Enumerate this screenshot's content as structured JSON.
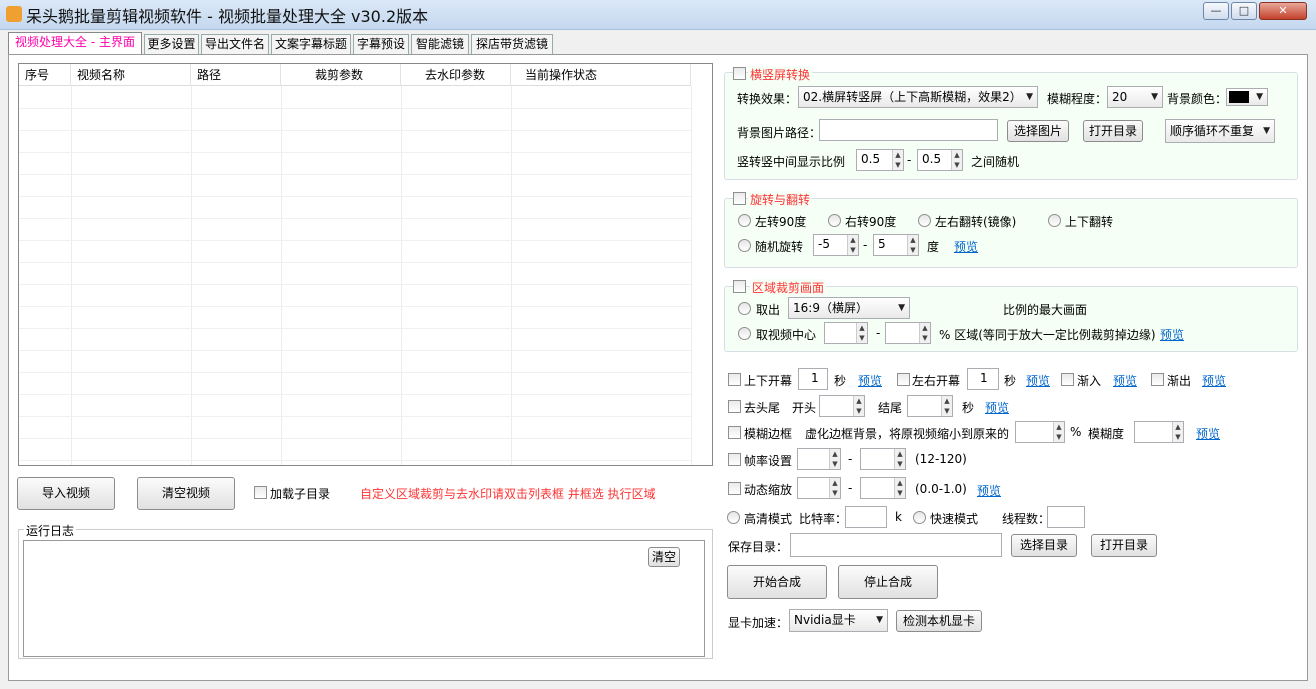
{
  "window": {
    "title": "呆头鹅批量剪辑视频软件 -  视频批量处理大全  v30.2版本",
    "minimize": "—",
    "maximize": "□",
    "close": "✕"
  },
  "tabs": [
    {
      "label": "视频处理大全 - 主界面"
    },
    {
      "label": "更多设置"
    },
    {
      "label": "导出文件名"
    },
    {
      "label": "文案字幕标题"
    },
    {
      "label": "字幕预设"
    },
    {
      "label": "智能滤镜"
    },
    {
      "label": "探店带货滤镜"
    }
  ],
  "table": {
    "columns": [
      "序号",
      "视频名称",
      "路径",
      "裁剪参数",
      "去水印参数",
      "当前操作状态"
    ]
  },
  "left_actions": {
    "import": "导入视频",
    "clear": "清空视频",
    "load_subdir": "加载子目录",
    "hint": "自定义区域裁剪与去水印请双击列表框 并框选 执行区域"
  },
  "log": {
    "title": "运行日志",
    "clear": "清空"
  },
  "orient": {
    "title": "横竖屏转换",
    "effect_label": "转换效果：",
    "effect_value": "02.横屏转竖屏（上下高斯模糊，效果2）",
    "blur_label": "模糊程度：",
    "blur_value": "20",
    "bgcolor_label": "背景颜色：",
    "bgcolor_value": "#000000",
    "bgimg_label": "背景图片路径：",
    "bgimg_value": "",
    "choose_img": "选择图片",
    "open_dir": "打开目录",
    "order_value": "顺序循环不重复",
    "ratio_label": "竖转竖中间显示比例",
    "ratio_min": "0.5",
    "ratio_max": "0.5",
    "ratio_suffix": "之间随机",
    "dash": "-"
  },
  "rotate": {
    "title": "旋转与翻转",
    "left90": "左转90度",
    "right90": "右转90度",
    "mirror": "左右翻转(镜像)",
    "flip": "上下翻转",
    "random": "随机旋转",
    "min": "-5",
    "max": "5",
    "unit": "度",
    "preview": "预览",
    "dash": "-"
  },
  "crop": {
    "title": "区域裁剪画面",
    "take": "取出",
    "ratio_value": "16:9（横屏）",
    "max_text": "比例的最大画面",
    "center": "取视频中心",
    "center_desc": "% 区域(等同于放大一定比例裁剪掉边缘)",
    "preview": "预览",
    "dash": "-"
  },
  "options": {
    "updown": "上下开幕",
    "updown_val": "1",
    "sec": "秒",
    "preview": "预览",
    "leftright": "左右开幕",
    "leftright_val": "1",
    "fadein": "渐入",
    "fadeout": "渐出",
    "trim": "去头尾",
    "trim_start": "开头",
    "trim_end": "结尾",
    "blur_border": "模糊边框",
    "blur_border_desc": "虚化边框背景，将原视频缩小到原来的",
    "percent": "%",
    "blur_degree": "模糊度",
    "fps": "帧率设置",
    "fps_range": "(12-120)",
    "zoom": "动态缩放",
    "zoom_range": "(0.0-1.0)",
    "hd": "高清模式",
    "bitrate": "比特率：",
    "k": "k",
    "fast": "快速模式",
    "threads": "线程数：",
    "save_dir": "保存目录：",
    "choose_dir": "选择目录",
    "open_dir": "打开目录",
    "start": "开始合成",
    "stop": "停止合成",
    "gpu_label": "显卡加速：",
    "gpu_value": "Nvidia显卡",
    "detect_gpu": "检测本机显卡",
    "dash": "-"
  }
}
